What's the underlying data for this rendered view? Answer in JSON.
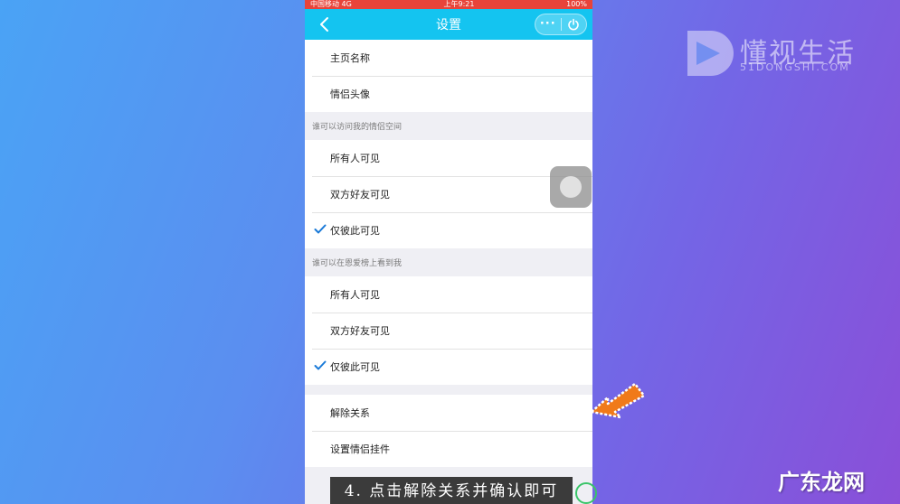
{
  "status_bar": {
    "carrier": "中国移动 4G",
    "time": "上午9:21",
    "battery": "100%"
  },
  "nav": {
    "title": "设置",
    "more": "···",
    "back_icon": "chevron-left-icon",
    "power_icon": "power-icon"
  },
  "groups": {
    "profile": [
      {
        "label": "主页名称"
      },
      {
        "label": "情侣头像"
      }
    ],
    "space_visibility": {
      "header": "谁可以访问我的情侣空间",
      "items": [
        {
          "label": "所有人可见",
          "checked": false
        },
        {
          "label": "双方好友可见",
          "checked": false
        },
        {
          "label": "仅彼此可见",
          "checked": true
        }
      ]
    },
    "leaderboard_visibility": {
      "header": "谁可以在恩爱榜上看到我",
      "items": [
        {
          "label": "所有人可见",
          "checked": false
        },
        {
          "label": "双方好友可见",
          "checked": false
        },
        {
          "label": "仅彼此可见",
          "checked": true
        }
      ]
    },
    "actions": [
      {
        "label": "解除关系"
      },
      {
        "label": "设置情侣挂件"
      }
    ]
  },
  "overlay": {
    "caption": "4. 点击解除关系并确认即可",
    "logo_title": "懂视生活",
    "logo_sub": "51DONGSHI.COM",
    "watermark": "广东龙网"
  },
  "colors": {
    "nav_bg": "#14c4f0",
    "status_bg": "#e8443a",
    "check": "#1a7ad8",
    "arrow": "#f07a1a"
  }
}
